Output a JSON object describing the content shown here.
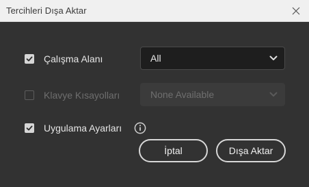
{
  "window": {
    "title": "Tercihleri Dışa Aktar"
  },
  "options": [
    {
      "label": "Çalışma Alanı",
      "checked": true,
      "enabled": true,
      "select_value": "All"
    },
    {
      "label": "Klavye Kısayolları",
      "checked": false,
      "enabled": false,
      "select_value": "None Available"
    },
    {
      "label": "Uygulama Ayarları",
      "checked": true,
      "enabled": true
    }
  ],
  "buttons": {
    "cancel": "İptal",
    "export": "Dışa Aktar"
  },
  "icons": {
    "close": "close-icon",
    "checkmark": "checkmark-icon",
    "chevron": "chevron-down-icon",
    "info": "info-icon"
  },
  "colors": {
    "background": "#323232",
    "titlebar": "#f0f0f0",
    "text": "#e6e6e6",
    "disabled_text": "#6e6e6e"
  }
}
